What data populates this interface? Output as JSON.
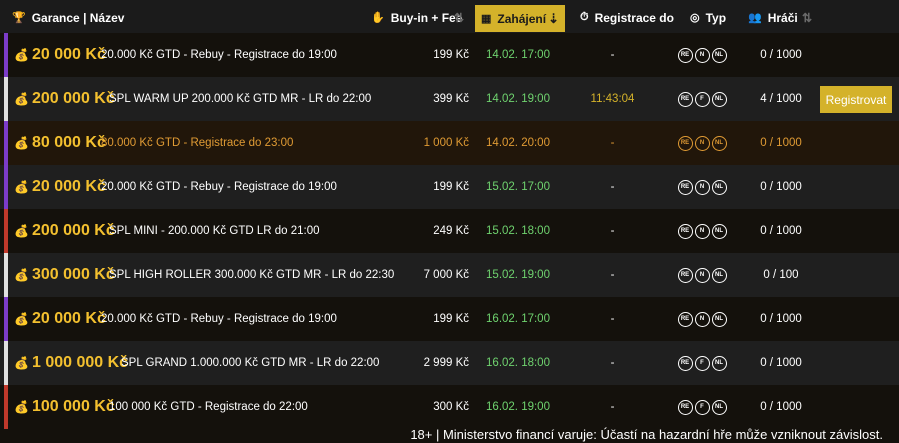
{
  "header": {
    "name_col": "Garance | Název",
    "buyin_col": "Buy-in + Fee",
    "start_col": "Zahájení",
    "reg_col": "Registrace do",
    "type_col": "Typ",
    "players_col": "Hráči"
  },
  "register_button": "Registrovat",
  "rows": [
    {
      "amount": "20 000 Kč",
      "desc": "20.000 Kč GTD - Rebuy - Registrace do 19:00",
      "buyin": "199 Kč",
      "start": "14.02. 17:00",
      "reg": "-",
      "types": [
        "RE",
        "N",
        "NL"
      ],
      "players": "0 / 1000",
      "stripe": "#7c3cc9"
    },
    {
      "amount": "200 000 Kč",
      "desc": "SPL WARM UP 200.000 Kč GTD MR - LR do 22:00",
      "buyin": "399 Kč",
      "start": "14.02. 19:00",
      "reg": "11:43:04",
      "types": [
        "RE",
        "F",
        "NL"
      ],
      "players": "4 / 1000",
      "stripe": "#e0e0e0"
    },
    {
      "amount": "80 000 Kč",
      "desc": "80.000 Kč GTD - Registrace do 23:00",
      "buyin": "1 000 Kč",
      "start": "14.02. 20:00",
      "reg": "-",
      "types": [
        "RE",
        "N",
        "NL"
      ],
      "players": "0 / 1000",
      "stripe": "#7c3cc9"
    },
    {
      "amount": "20 000 Kč",
      "desc": "20.000 Kč GTD - Rebuy - Registrace do 19:00",
      "buyin": "199 Kč",
      "start": "15.02. 17:00",
      "reg": "-",
      "types": [
        "RE",
        "N",
        "NL"
      ],
      "players": "0 / 1000",
      "stripe": "#7c3cc9"
    },
    {
      "amount": "200 000 Kč",
      "desc": "SPL MINI - 200.000 Kč GTD LR do 21:00",
      "buyin": "249 Kč",
      "start": "15.02. 18:00",
      "reg": "-",
      "types": [
        "RE",
        "N",
        "NL"
      ],
      "players": "0 / 1000",
      "stripe": "#c0392b"
    },
    {
      "amount": "300 000 Kč",
      "desc": "SPL HIGH ROLLER 300.000 Kč GTD MR - LR do 22:30",
      "buyin": "7 000 Kč",
      "start": "15.02. 19:00",
      "reg": "-",
      "types": [
        "RE",
        "N",
        "NL"
      ],
      "players": "0 / 100",
      "stripe": "#e0e0e0"
    },
    {
      "amount": "20 000 Kč",
      "desc": "20.000 Kč GTD - Rebuy - Registrace do 19:00",
      "buyin": "199 Kč",
      "start": "16.02. 17:00",
      "reg": "-",
      "types": [
        "RE",
        "N",
        "NL"
      ],
      "players": "0 / 1000",
      "stripe": "#7c3cc9"
    },
    {
      "amount": "1 000 000 Kč",
      "desc": "SPL GRAND 1.000.000 Kč GTD MR - LR do 22:00",
      "buyin": "2 999 Kč",
      "start": "16.02. 18:00",
      "reg": "-",
      "types": [
        "RE",
        "F",
        "NL"
      ],
      "players": "0 / 1000",
      "stripe": "#e0e0e0"
    },
    {
      "amount": "100 000 Kč",
      "desc": "100 000 Kč GTD - Registrace do 22:00",
      "buyin": "300 Kč",
      "start": "16.02. 19:00",
      "reg": "-",
      "types": [
        "RE",
        "F",
        "NL"
      ],
      "players": "0 / 1000",
      "stripe": "#c0392b"
    }
  ],
  "disclaimer": "18+ | Ministerstvo financí varuje: Účastí na hazardní hře může vzniknout závislost.",
  "colors": {
    "accent_gold": "#d4b22a",
    "amount_gold": "#f3c02f",
    "start_green": "#6fd36f",
    "featured_orange": "#e09b34"
  }
}
